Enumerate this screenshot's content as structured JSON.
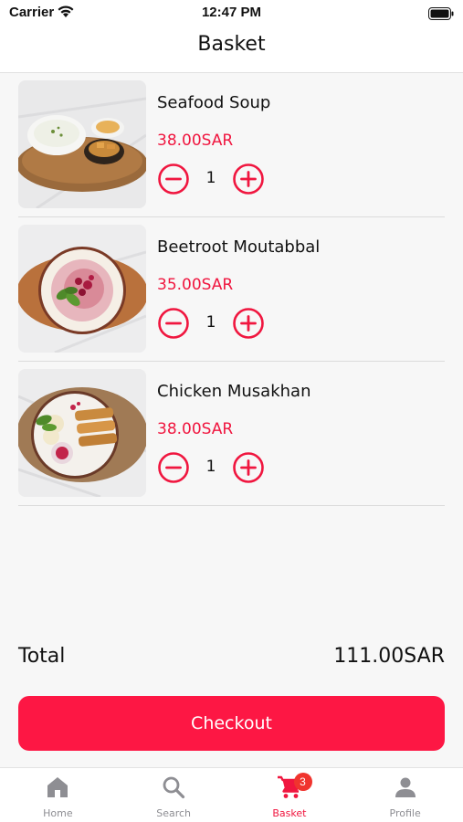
{
  "status_bar": {
    "carrier": "Carrier",
    "time": "12:47 PM",
    "icons": [
      "wifi-icon",
      "battery-icon"
    ]
  },
  "header": {
    "title": "Basket"
  },
  "basket": {
    "items": [
      {
        "name": "Seafood Soup",
        "price": "38.00SAR",
        "quantity": "1"
      },
      {
        "name": "Beetroot Moutabbal",
        "price": "35.00SAR",
        "quantity": "1"
      },
      {
        "name": "Chicken Musakhan",
        "price": "38.00SAR",
        "quantity": "1"
      }
    ],
    "stepper_icons": {
      "minus": "minus-circle-icon",
      "plus": "plus-circle-icon"
    }
  },
  "summary": {
    "total_label": "Total",
    "total_value": "111.00SAR"
  },
  "checkout": {
    "label": "Checkout"
  },
  "tabs": [
    {
      "label": "Home",
      "icon": "home-icon"
    },
    {
      "label": "Search",
      "icon": "search-icon"
    },
    {
      "label": "Basket",
      "icon": "cart-icon",
      "badge": "3",
      "active": true
    },
    {
      "label": "Profile",
      "icon": "person-icon"
    }
  ],
  "colors": {
    "accent": "#f0163f",
    "checkout_bg": "#fd1744",
    "badge": "#f0342e",
    "inactive_tab": "#8e8e93"
  }
}
